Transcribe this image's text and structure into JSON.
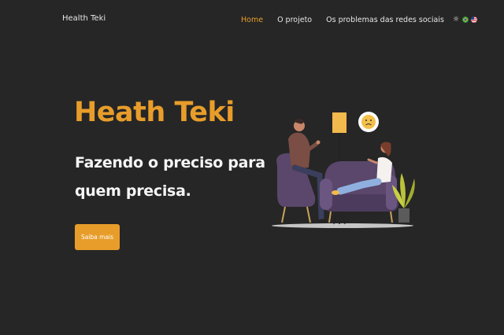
{
  "header": {
    "brand": "Health Teki",
    "nav": [
      {
        "label": "Home",
        "active": true
      },
      {
        "label": "O projeto",
        "active": false
      },
      {
        "label": "Os problemas das redes sociais",
        "active": false
      }
    ],
    "icons": [
      "theme-toggle-sun-icon",
      "brazil-flag-icon",
      "usa-flag-icon"
    ]
  },
  "hero": {
    "title": "Heath Teki",
    "subtitle_line1": "Fazendo o preciso para",
    "subtitle_line2": "quem precisa.",
    "cta_label": "Saiba mais"
  },
  "colors": {
    "background": "#262626",
    "accent": "#e89d2b",
    "text": "#f5f5f5"
  }
}
